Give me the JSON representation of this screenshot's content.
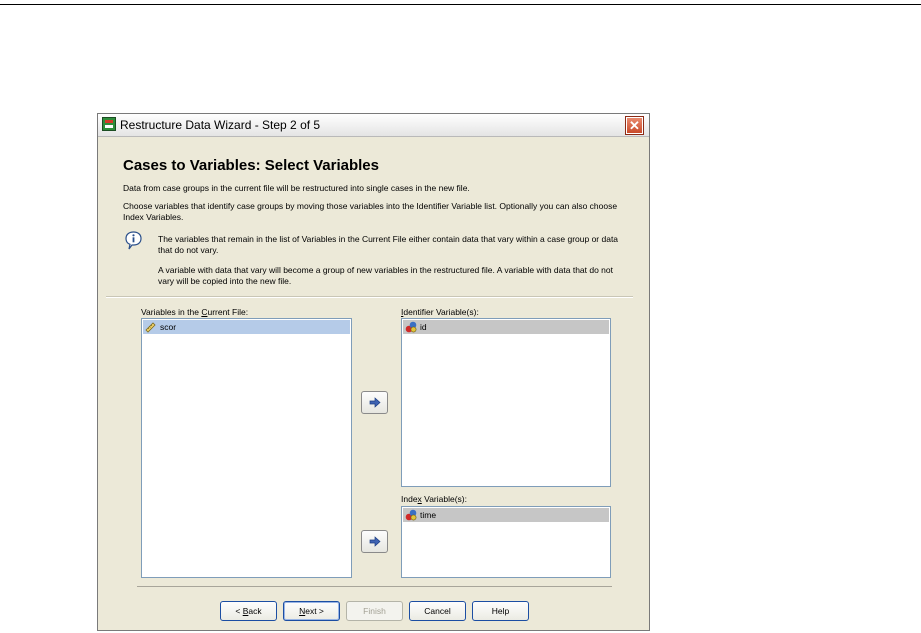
{
  "window": {
    "title": "Restructure Data Wizard - Step 2 of 5",
    "close_glyph": "✕",
    "icon": "spss-app-icon"
  },
  "content": {
    "heading": "Cases to Variables: Select Variables",
    "para1": "Data from case groups in the current file will be restructured into single cases in the new file.",
    "para2": "Choose variables that identify case groups by moving those variables into the Identifier Variable list. Optionally you can also choose Index Variables.",
    "info1": "The variables that remain in the list of Variables in the Current File either contain data that vary within a case group or data that do not vary.",
    "info2": "A variable with data that vary will become a group of new variables in the restructured file. A variable with data that do not vary will be copied into the new file."
  },
  "source_list": {
    "label_pre": "Variables in the ",
    "label_mnemonic": "C",
    "label_post": "urrent File:",
    "items": [
      {
        "name": "scor",
        "icon": "scale-ruler-icon"
      }
    ]
  },
  "identifier_list": {
    "label_mnemonic": "I",
    "label_post": "dentifier Variable(s):",
    "items": [
      {
        "name": "id",
        "icon": "nominal-variable-icon"
      }
    ]
  },
  "index_list": {
    "label_pre": "Inde",
    "label_mnemonic": "x",
    "label_post": " Variable(s):",
    "items": [
      {
        "name": "time",
        "icon": "nominal-variable-icon"
      }
    ]
  },
  "buttons": {
    "back_pre": "< ",
    "back_mnemonic": "B",
    "back_post": "ack",
    "next_mnemonic": "N",
    "next_post": "ext >",
    "finish": "Finish",
    "cancel": "Cancel",
    "help": "Help"
  },
  "colors": {
    "dialog_bg": "#ece9d8",
    "selection_blue": "#b5cbe8",
    "selection_grey": "#c6c6c6",
    "button_border": "#1c4ea3"
  }
}
